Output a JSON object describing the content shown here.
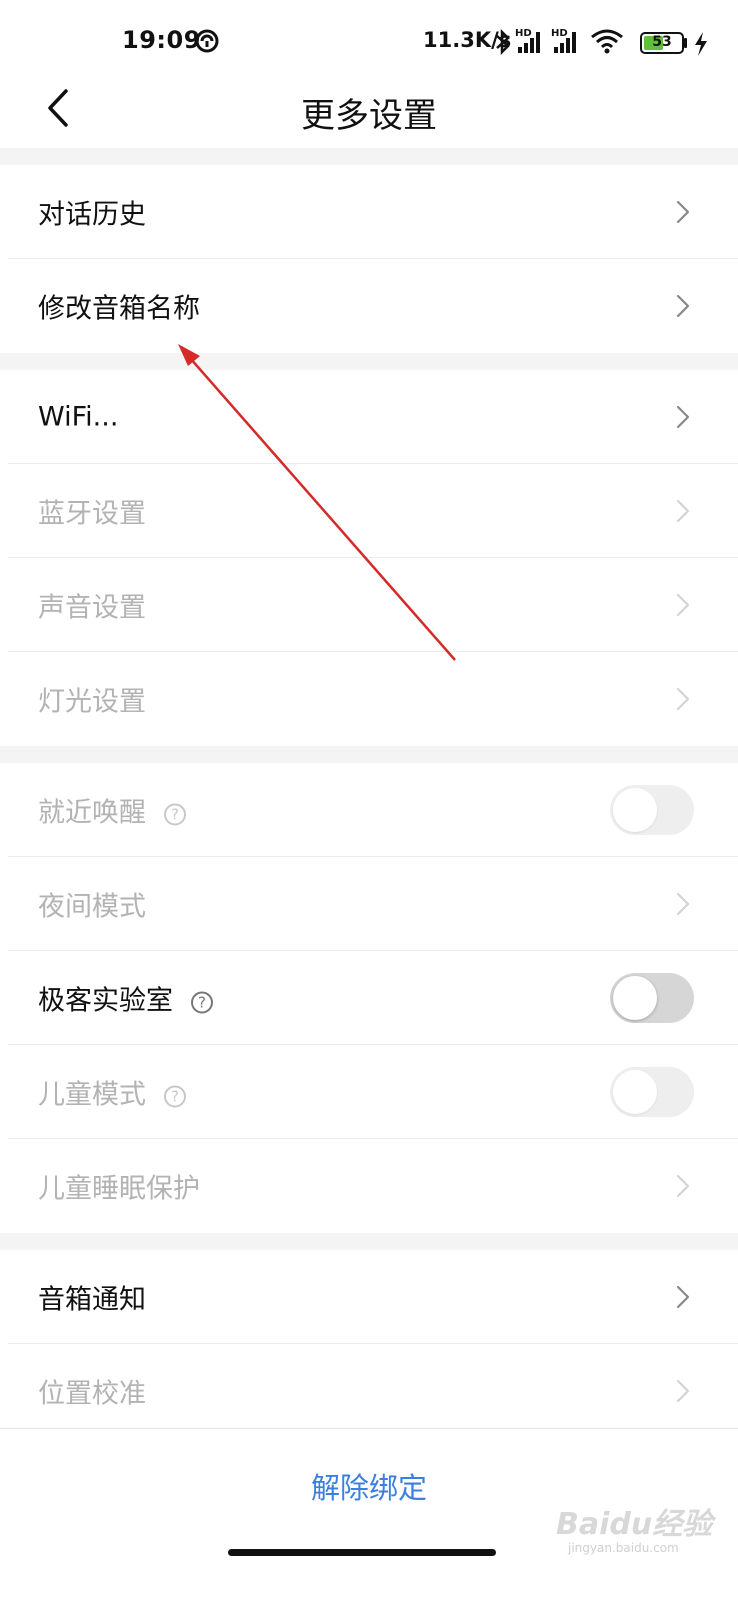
{
  "status_bar": {
    "time": "19:09",
    "network_speed": "11.3K/s",
    "battery_level": 53,
    "battery_label": "53",
    "battery_color": "#5fbf3a",
    "icons": [
      "do-not-disturb-icon",
      "bluetooth-icon",
      "hd-signal-icon",
      "hd-signal-icon",
      "wifi-icon",
      "battery-icon",
      "charging-icon"
    ]
  },
  "header": {
    "title": "更多设置"
  },
  "groups": [
    [
      {
        "label": "对话历史",
        "state": "enabled",
        "control": "chevron",
        "help": false
      },
      {
        "label": "修改音箱名称",
        "state": "enabled",
        "control": "chevron",
        "help": false
      }
    ],
    [
      {
        "label": "WiFi...",
        "state": "enabled",
        "control": "chevron",
        "help": false
      },
      {
        "label": "蓝牙设置",
        "state": "disabled",
        "control": "chevron",
        "help": false
      },
      {
        "label": "声音设置",
        "state": "disabled",
        "control": "chevron",
        "help": false
      },
      {
        "label": "灯光设置",
        "state": "disabled",
        "control": "chevron",
        "help": false
      }
    ],
    [
      {
        "label": "就近唤醒",
        "state": "disabled",
        "control": "switch",
        "switch_on": false,
        "help": true
      },
      {
        "label": "夜间模式",
        "state": "disabled",
        "control": "chevron",
        "help": false
      },
      {
        "label": "极客实验室",
        "state": "enabled",
        "control": "switch",
        "switch_on": false,
        "help": true
      },
      {
        "label": "儿童模式",
        "state": "disabled",
        "control": "switch",
        "switch_on": false,
        "help": true
      },
      {
        "label": "儿童睡眠保护",
        "state": "disabled",
        "control": "chevron",
        "help": false
      }
    ],
    [
      {
        "label": "音箱通知",
        "state": "enabled",
        "control": "chevron",
        "help": false
      },
      {
        "label": "位置校准",
        "state": "disabled",
        "control": "chevron",
        "help": false
      }
    ]
  ],
  "help_glyph": "?",
  "footer": {
    "unbind_label": "解除绑定",
    "watermark": "Baidu经验",
    "watermark_url": "jingyan.baidu.com"
  },
  "colors": {
    "text_enabled": "#111111",
    "text_disabled": "#b3b3b3",
    "accent_blue": "#3b7fe0",
    "section_gap": "#f4f4f4",
    "annotation_arrow": "#d42a2a"
  }
}
